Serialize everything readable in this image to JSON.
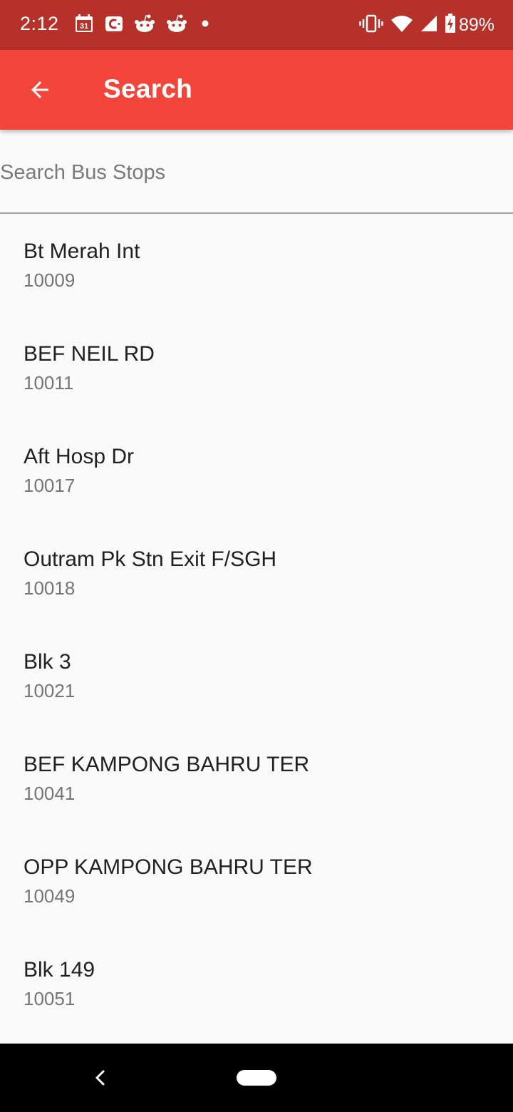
{
  "status_bar": {
    "time": "2:12",
    "calendar_day": "31",
    "battery": "89%",
    "background_color": "#b5312a",
    "icons_left": [
      "calendar-icon",
      "app-c-icon",
      "reddit-icon",
      "reddit-icon",
      "notification-dot-icon"
    ],
    "icons_right": [
      "vibrate-icon",
      "wifi-icon",
      "signal-icon",
      "battery-charging-icon"
    ]
  },
  "app_bar": {
    "title": "Search",
    "back_icon": "arrow-back-icon",
    "color": "#f4453a"
  },
  "search": {
    "placeholder": "Search Bus Stops",
    "value": ""
  },
  "stops": [
    {
      "name": "Bt Merah Int",
      "code": "10009"
    },
    {
      "name": "BEF NEIL RD",
      "code": "10011"
    },
    {
      "name": "Aft Hosp Dr",
      "code": "10017"
    },
    {
      "name": "Outram Pk Stn Exit F/SGH",
      "code": "10018"
    },
    {
      "name": "Blk 3",
      "code": "10021"
    },
    {
      "name": "BEF KAMPONG BAHRU TER",
      "code": "10041"
    },
    {
      "name": "OPP KAMPONG BAHRU TER",
      "code": "10049"
    },
    {
      "name": "Blk 149",
      "code": "10051"
    }
  ],
  "nav_bar": {
    "back_icon": "nav-back-icon",
    "home_icon": "nav-home-pill-icon"
  }
}
